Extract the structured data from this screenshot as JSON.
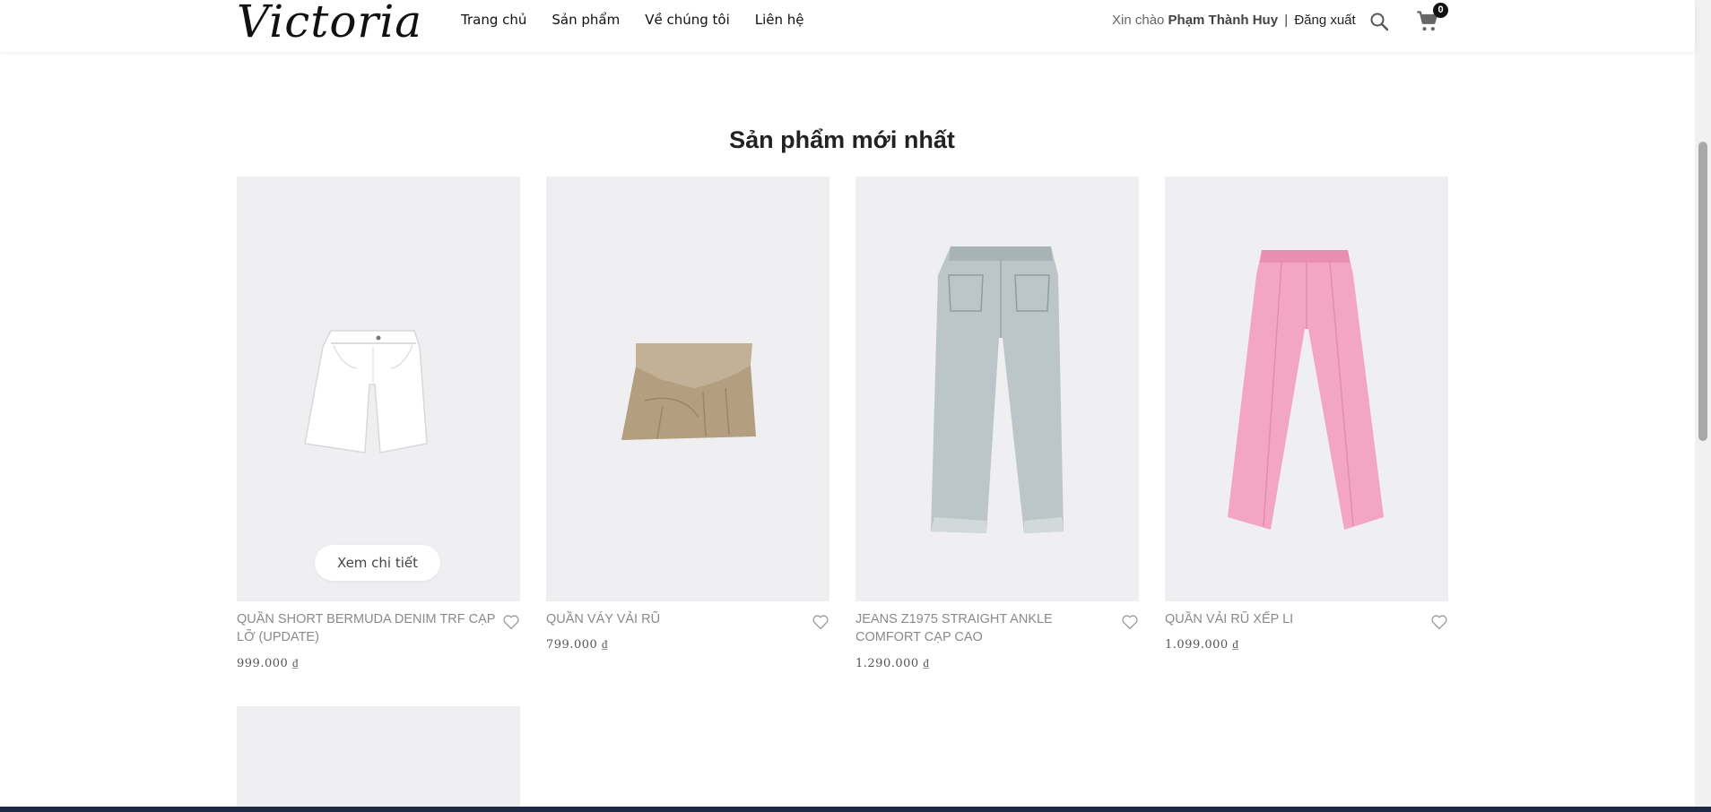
{
  "brand": {
    "logo": "Victoria"
  },
  "nav": [
    "Trang chủ",
    "Sản phẩm",
    "Về chúng tôi",
    "Liên hệ"
  ],
  "account": {
    "greeting": "Xin chào",
    "user": "Phạm Thành Huy",
    "separator": "|",
    "logout": "Đăng xuất"
  },
  "cart": {
    "count": "0"
  },
  "section": {
    "title": "Sản phẩm mới nhất"
  },
  "products": [
    {
      "name": "QUẦN SHORT BERMUDA DENIM TRF CẠP LỠ (UPDATE)",
      "price": "999.000 ₫",
      "image": "white-denim-shorts"
    },
    {
      "name": "QUẦN VÁY VẢI RŨ",
      "price": "799.000 ₫",
      "image": "beige-skort"
    },
    {
      "name": "JEANS Z1975 STRAIGHT ANKLE COMFORT CẠP CAO",
      "price": "1.290.000 ₫",
      "image": "light-blue-jeans"
    },
    {
      "name": "QUẦN VẢI RŨ XẾP LI",
      "price": "1.099.000 ₫",
      "image": "pink-pleated-trousers"
    }
  ],
  "detail_button": "Xem chi tiết",
  "colors": {
    "accent": "#111111",
    "card_bg": "#efeff2",
    "pink": "#f4a7c4",
    "denim": "#b9c3c4",
    "beige": "#bda98d"
  }
}
